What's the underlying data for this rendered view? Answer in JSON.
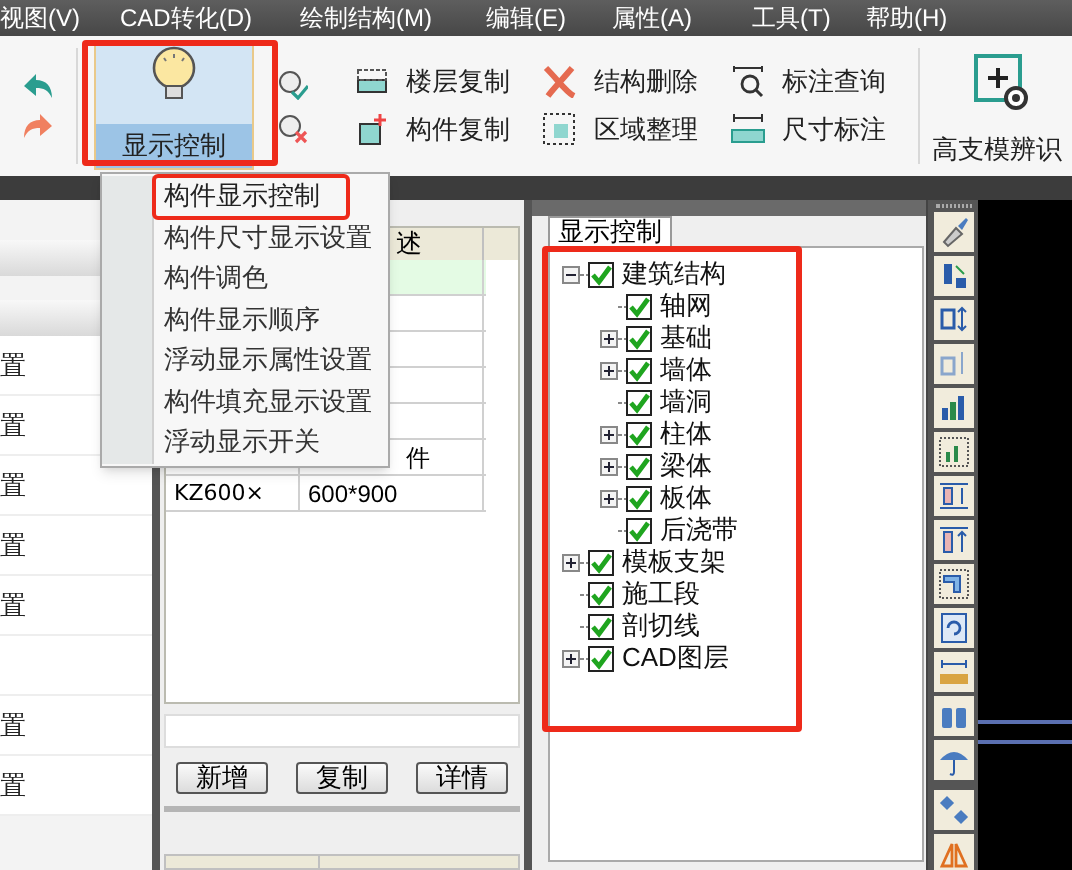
{
  "menu_bar": [
    "视图(V)",
    "CAD转化(D)",
    "绘制结构(M)",
    "编辑(E)",
    "属性(A)",
    "工具(T)",
    "帮助(H)"
  ],
  "ribbon": {
    "display_button": {
      "label": "显示控制",
      "selected": true
    },
    "tools": [
      {
        "label": "楼层复制",
        "kind": "floor"
      },
      {
        "label": "构件复制",
        "kind": "copy"
      },
      {
        "label": "结构删除",
        "kind": "delete"
      },
      {
        "label": "区域整理",
        "kind": "area"
      },
      {
        "label": "标注查询",
        "kind": "query"
      },
      {
        "label": "尺寸标注",
        "kind": "dim"
      }
    ],
    "recognize_button": {
      "label": "高支模辨识"
    }
  },
  "popup_menu": [
    {
      "label": "构件显示控制",
      "selected": true
    },
    {
      "label": "构件尺寸显示设置",
      "selected": false
    },
    {
      "label": "构件调色",
      "selected": false
    },
    {
      "label": "构件显示顺序",
      "selected": false
    },
    {
      "label": "浮动显示属性设置",
      "selected": false
    },
    {
      "label": "构件填充显示设置",
      "selected": false
    },
    {
      "label": "浮动显示开关",
      "selected": false
    }
  ],
  "left_panel": {
    "rows": [
      {
        "text": "置"
      },
      {
        "text": "置"
      },
      {
        "text": "置"
      },
      {
        "text": "置"
      },
      {
        "text": "置"
      },
      {},
      {
        "text": "置"
      },
      {
        "text": "置"
      }
    ]
  },
  "table": {
    "header": {
      "column_2": "述"
    },
    "rows": [
      {
        "selected": true
      },
      {
        "selected": false
      },
      {
        "selected": false
      },
      {
        "selected": false
      },
      {
        "selected": false
      },
      {
        "selected": false,
        "column_2": "件"
      },
      {
        "selected": false,
        "column_1": "KZ600×",
        "column_2": "600*900"
      }
    ]
  },
  "buttons": [
    "新增",
    "复制",
    "详情"
  ],
  "tree_panel": {
    "tab": "显示控制",
    "nodes": [
      {
        "label": "建筑结构",
        "checked": true,
        "expanded": true,
        "children": [
          {
            "label": "轴网",
            "checked": true
          },
          {
            "label": "基础",
            "checked": true,
            "expanded": false
          },
          {
            "label": "墙体",
            "checked": true,
            "expanded": false
          },
          {
            "label": "墙洞",
            "checked": true
          },
          {
            "label": "柱体",
            "checked": true,
            "expanded": false
          },
          {
            "label": "梁体",
            "checked": true,
            "expanded": false
          },
          {
            "label": "板体",
            "checked": true,
            "expanded": false
          },
          {
            "label": "后浇带",
            "checked": true
          }
        ]
      },
      {
        "label": "模板支架",
        "checked": true,
        "expanded": false
      },
      {
        "label": "施工段",
        "checked": true
      },
      {
        "label": "剖切线",
        "checked": true
      },
      {
        "label": "CAD图层",
        "checked": true,
        "expanded": false
      }
    ]
  }
}
